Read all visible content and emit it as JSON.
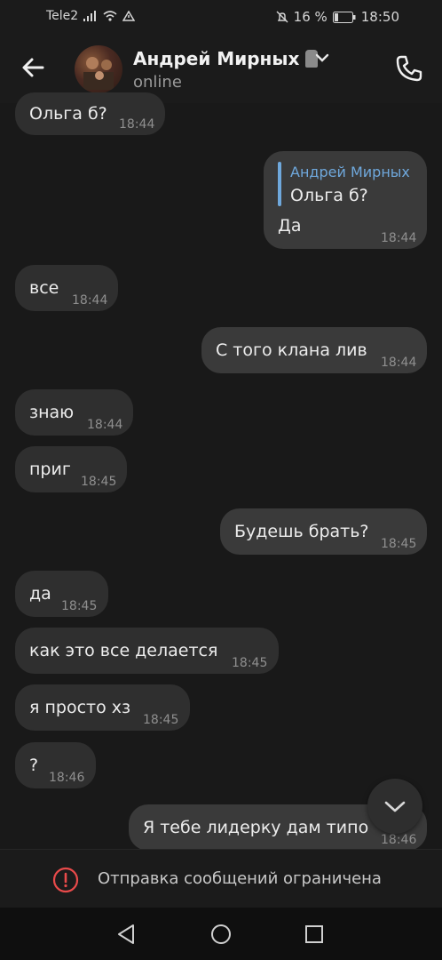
{
  "statusbar": {
    "carrier": "Tele2",
    "battery": "16 %",
    "time": "18:50"
  },
  "header": {
    "name": "Андрей Мирных",
    "status": "online"
  },
  "messages": [
    {
      "text": "Ольга б?",
      "time": "18:44"
    },
    {
      "reply_author": "Андрей Мирных",
      "reply_text": "Ольга б?",
      "text": "Да",
      "time": "18:44"
    },
    {
      "text": "все",
      "time": "18:44"
    },
    {
      "text": "С того клана лив",
      "time": "18:44"
    },
    {
      "text": "знаю",
      "time": "18:44"
    },
    {
      "text": "приг",
      "time": "18:45"
    },
    {
      "text": "Будешь брать?",
      "time": "18:45"
    },
    {
      "text": "да",
      "time": "18:45"
    },
    {
      "text": "как это все делается",
      "time": "18:45"
    },
    {
      "text": "я просто хз",
      "time": "18:45"
    },
    {
      "text": "?",
      "time": "18:46"
    },
    {
      "text": "Я тебе лидерку дам типо",
      "time": "18:46"
    }
  ],
  "footer": {
    "restricted_text": "Отправка сообщений ограничена"
  },
  "colors": {
    "accent": "#6fa8dc",
    "error": "#e84a4a"
  }
}
